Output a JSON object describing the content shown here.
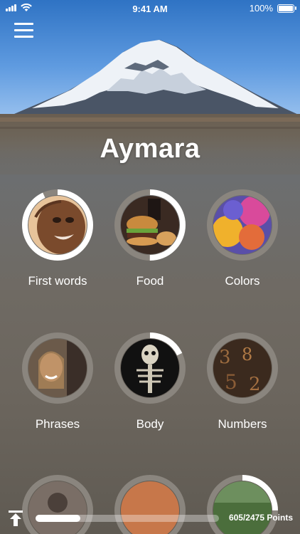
{
  "status_bar": {
    "time": "9:41 AM",
    "battery": "100%"
  },
  "header": {
    "title": "Aymara",
    "menu_icon": "hamburger-menu-icon"
  },
  "categories": [
    {
      "label": "First words",
      "progress": 0.93,
      "complete_style": true
    },
    {
      "label": "Food",
      "progress": 0.5
    },
    {
      "label": "Colors",
      "progress": 0.0
    },
    {
      "label": "Phrases",
      "progress": 0.0
    },
    {
      "label": "Body",
      "progress": 0.18
    },
    {
      "label": "Numbers",
      "progress": 0.0
    }
  ],
  "footer": {
    "points_text": "605/2475 Points",
    "progress": 0.244,
    "upload_icon": "scroll-to-top-icon"
  },
  "colors": {
    "accent": "#ffffff",
    "ring_track": "#8a857e"
  }
}
